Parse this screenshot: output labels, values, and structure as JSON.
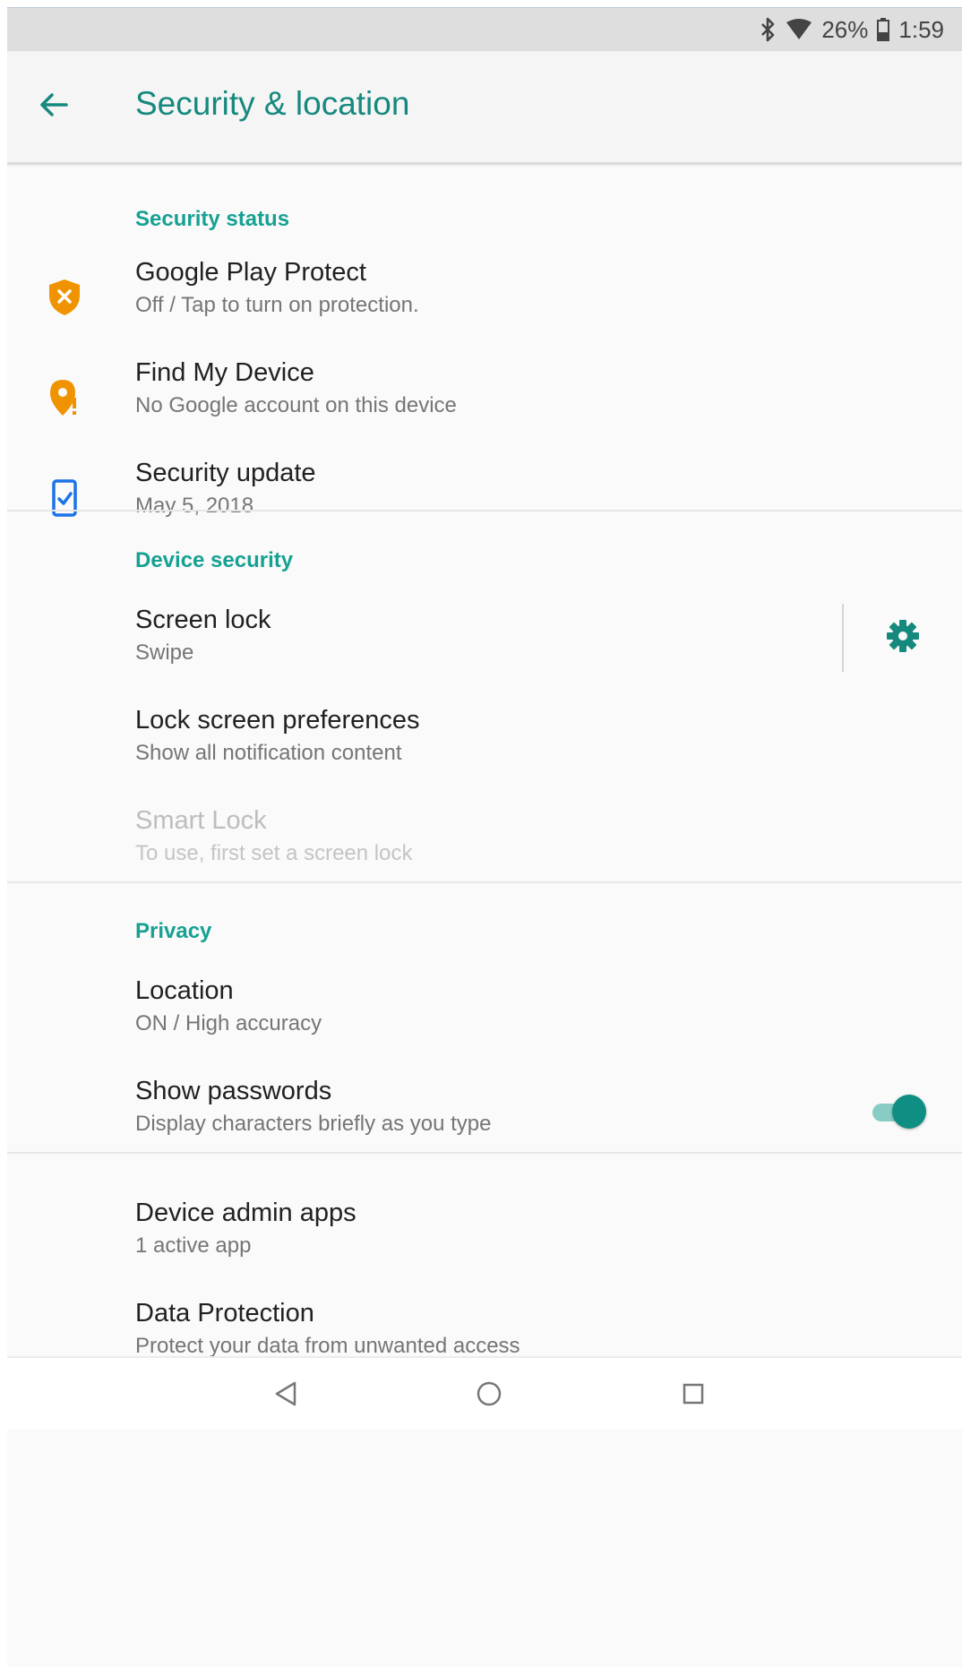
{
  "status_bar": {
    "battery": "26%",
    "time": "1:59",
    "icons": [
      "bluetooth-icon",
      "wifi-icon",
      "battery-icon"
    ]
  },
  "app_bar": {
    "title": "Security & location",
    "back_icon": "arrow-back-icon"
  },
  "sections": {
    "security_status": {
      "header": "Security status",
      "items": [
        {
          "title": "Google Play Protect",
          "summary": "Off / Tap to turn on protection.",
          "icon": "shield-warning-icon"
        },
        {
          "title": "Find My Device",
          "summary": "No Google account on this device",
          "icon": "location-warning-icon"
        },
        {
          "title": "Security update",
          "summary": "May 5, 2018",
          "icon": "phone-check-icon"
        }
      ]
    },
    "device_security": {
      "header": "Device security",
      "items": [
        {
          "title": "Screen lock",
          "summary": "Swipe",
          "icon": "gear-icon"
        },
        {
          "title": "Lock screen preferences",
          "summary": "Show all notification content"
        },
        {
          "title": "Smart Lock",
          "summary": "To use, first set a screen lock",
          "enabled": false
        }
      ]
    },
    "privacy": {
      "header": "Privacy",
      "items": [
        {
          "title": "Location",
          "summary": "ON / High accuracy"
        },
        {
          "title": "Show passwords",
          "summary": "Display characters briefly as you type",
          "toggle_on": true
        }
      ]
    },
    "other": {
      "items": [
        {
          "title": "Device admin apps",
          "summary": "1 active app"
        },
        {
          "title": "Data Protection",
          "summary": "Protect your data from unwanted access"
        }
      ]
    }
  },
  "nav_bar": {
    "icons": [
      "back-triangle-icon",
      "home-circle-icon",
      "recents-square-icon"
    ]
  },
  "colors": {
    "accent": "#16897e",
    "section_header": "#16a193",
    "warning": "#f09300",
    "info_blue": "#1a73e8",
    "toggle_thumb": "#0f8f83"
  }
}
